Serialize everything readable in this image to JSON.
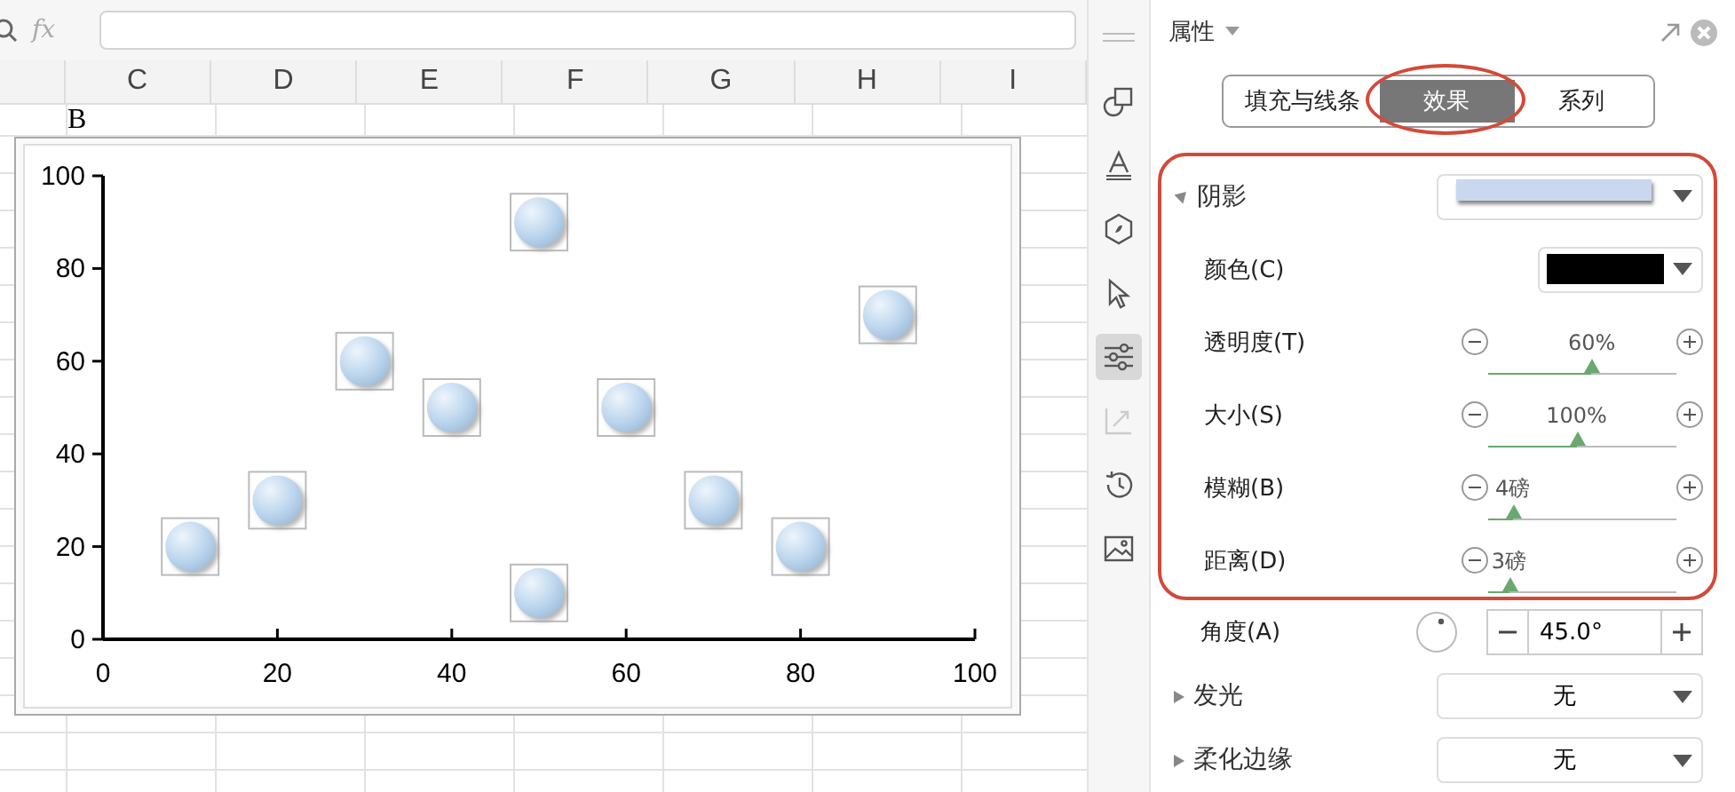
{
  "formula_bar": {
    "label": "fx"
  },
  "columns": [
    "C",
    "D",
    "E",
    "F",
    "G",
    "H",
    "I"
  ],
  "cell_text": "B",
  "chart": {
    "chart_data": {
      "type": "scatter",
      "x": [
        10,
        20,
        30,
        40,
        50,
        50,
        60,
        70,
        80,
        90
      ],
      "series": [
        {
          "color": "#bcd6ee",
          "values": [
            20,
            30,
            60,
            50,
            90,
            10,
            50,
            30,
            20,
            70
          ]
        }
      ],
      "xlim": [
        0,
        100
      ],
      "ylim": [
        0,
        100
      ],
      "xticks": [
        0,
        20,
        40,
        60,
        80,
        100
      ],
      "yticks": [
        0,
        20,
        40,
        60,
        80,
        100
      ]
    }
  },
  "side_tools": [
    {
      "kind": "handle",
      "selected": false,
      "disabled": false
    },
    {
      "kind": "shapes",
      "selected": false,
      "disabled": false
    },
    {
      "kind": "text",
      "selected": false,
      "disabled": false
    },
    {
      "kind": "fill",
      "selected": false,
      "disabled": false
    },
    {
      "kind": "cursor",
      "selected": false,
      "disabled": false
    },
    {
      "kind": "sliders",
      "selected": true,
      "disabled": false
    },
    {
      "kind": "transform",
      "selected": false,
      "disabled": true
    },
    {
      "kind": "history",
      "selected": false,
      "disabled": false
    },
    {
      "kind": "image",
      "selected": false,
      "disabled": false
    }
  ],
  "panel": {
    "title": "属性",
    "tabs": [
      {
        "label": "填充与线条",
        "selected": false
      },
      {
        "label": "效果",
        "selected": true
      },
      {
        "label": "系列",
        "selected": false
      }
    ],
    "shadow": {
      "label": "阴影",
      "expanded": true,
      "rows": [
        {
          "kind": "color",
          "label": "颜色(C)"
        },
        {
          "kind": "slider",
          "label": "透明度(T)",
          "reading": "60%",
          "level": 0.55
        },
        {
          "kind": "slider",
          "label": "大小(S)",
          "reading": "100%",
          "level": 0.47
        },
        {
          "kind": "slider",
          "label": "模糊(B)",
          "reading": "4磅",
          "level": 0.13
        },
        {
          "kind": "slider",
          "label": "距离(D)",
          "reading": "3磅",
          "level": 0.11
        }
      ]
    },
    "angle": {
      "label": "角度(A)",
      "value": "45.0°"
    },
    "sections": [
      {
        "label": "发光",
        "expanded": false,
        "value": "无"
      },
      {
        "label": "柔化边缘",
        "expanded": false,
        "value": "无"
      }
    ]
  }
}
